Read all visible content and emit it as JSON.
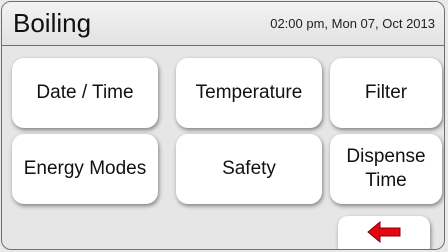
{
  "header": {
    "title": "Boiling",
    "datetime": "02:00 pm, Mon 07, Oct 2013"
  },
  "menu": {
    "date_time": "Date / Time",
    "temperature": "Temperature",
    "filter": "Filter",
    "energy_modes": "Energy Modes",
    "safety": "Safety",
    "dispense_time_line1": "Dispense",
    "dispense_time_line2": "Time"
  },
  "nav": {
    "back_icon": "left-arrow-icon",
    "back_icon_color": "#e30613"
  },
  "colors": {
    "tile_background": "#ffffff",
    "screen_background": "#e6e6e6"
  }
}
